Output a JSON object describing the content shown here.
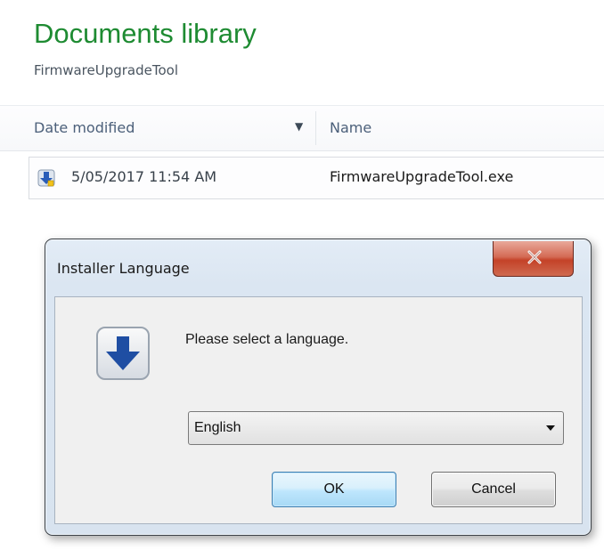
{
  "library": {
    "title": "Documents library",
    "subtitle": "FirmwareUpgradeTool",
    "columns": {
      "date_modified": "Date modified",
      "name": "Name"
    },
    "files": [
      {
        "date": "5/05/2017 11:54 AM",
        "name": "FirmwareUpgradeTool.exe",
        "icon": "installer-icon"
      }
    ]
  },
  "dialog": {
    "title": "Installer Language",
    "close_icon": "close-x-icon",
    "prompt": "Please select a language.",
    "language_selected": "English",
    "ok_label": "OK",
    "cancel_label": "Cancel",
    "colors": {
      "title_green": "#1e8b32",
      "close_red": "#c44228",
      "icon_blue": "#1f4ea3"
    }
  }
}
